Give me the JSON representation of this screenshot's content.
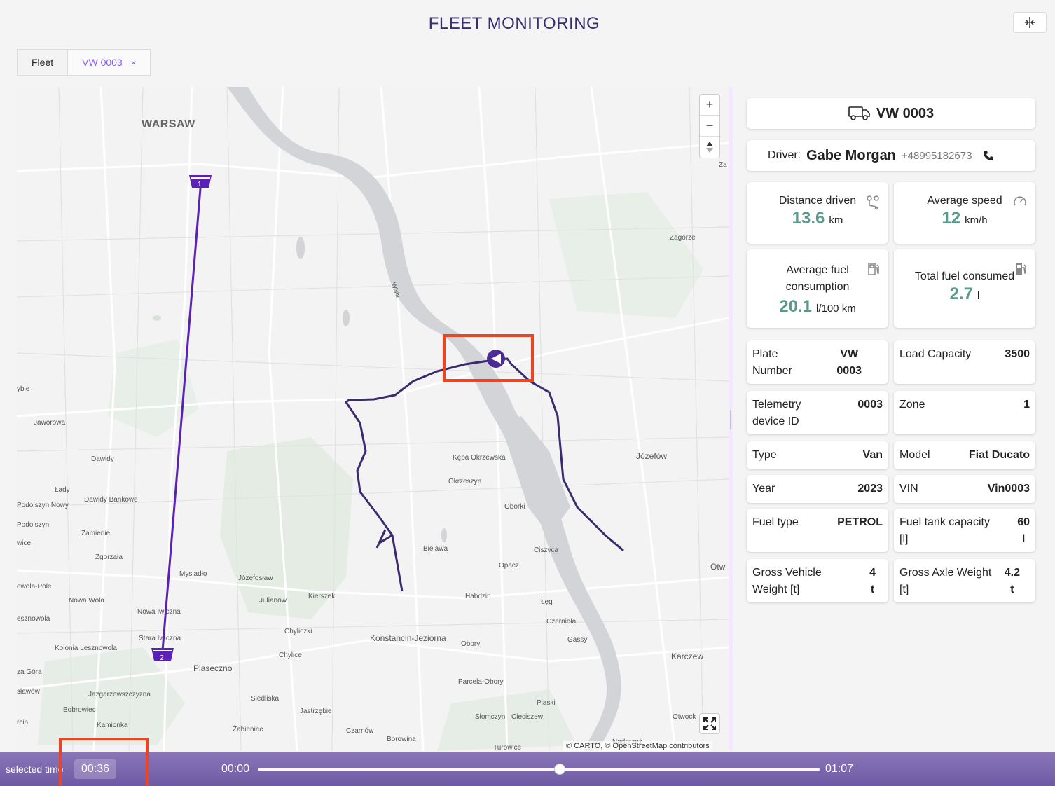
{
  "header": {
    "title": "FLEET MONITORING",
    "layout_toggle_icon": "split-view-icon"
  },
  "tabs": [
    {
      "label": "Fleet",
      "active": false
    },
    {
      "label": "VW 0003",
      "active": true,
      "close": "×"
    }
  ],
  "map": {
    "labels": [
      {
        "text": "WARSAW"
      },
      {
        "text": "Zagórze"
      },
      {
        "text": "Józefów"
      },
      {
        "text": "Kępa Okrzewska"
      },
      {
        "text": "Okrzeszyn"
      },
      {
        "text": "Oborki"
      },
      {
        "text": "Bielawa"
      },
      {
        "text": "Ciszyca"
      },
      {
        "text": "Opacz"
      },
      {
        "text": "Habdzin"
      },
      {
        "text": "Łęg"
      },
      {
        "text": "Czernidła"
      },
      {
        "text": "Gassy"
      },
      {
        "text": "Konstancin-Jeziorna"
      },
      {
        "text": "Obory"
      },
      {
        "text": "Karczew"
      },
      {
        "text": "Piaseczno"
      },
      {
        "text": "Chylice"
      },
      {
        "text": "Chyliczki"
      },
      {
        "text": "Kierszek"
      },
      {
        "text": "Józefosław"
      },
      {
        "text": "Julianów"
      },
      {
        "text": "Mysiadło"
      },
      {
        "text": "Nowa Iwiczna"
      },
      {
        "text": "Stara Iwiczna"
      },
      {
        "text": "Jaworowa"
      },
      {
        "text": "Dawidy"
      },
      {
        "text": "Dawidy Bankowe"
      },
      {
        "text": "Łady"
      },
      {
        "text": "Podolszyn Nowy"
      },
      {
        "text": "Podolszyn"
      },
      {
        "text": "Zamienie"
      },
      {
        "text": "Zgorzała"
      },
      {
        "text": "Nowa Wola"
      },
      {
        "text": "Kolonia Lesznowola"
      },
      {
        "text": "Jazgarzewszczyzna"
      },
      {
        "text": "Bobrowiec"
      },
      {
        "text": "Kamionka"
      },
      {
        "text": "Siedliska"
      },
      {
        "text": "Jastrzębie"
      },
      {
        "text": "Żabieniec"
      },
      {
        "text": "Czarnów"
      },
      {
        "text": "Borowina"
      },
      {
        "text": "Parcela-Obory"
      },
      {
        "text": "Piaski"
      },
      {
        "text": "Słomczyn"
      },
      {
        "text": "Cieciszew"
      },
      {
        "text": "Otwock"
      },
      {
        "text": "Turowice"
      },
      {
        "text": "Nadbrzeż"
      },
      {
        "text": "Otw"
      },
      {
        "text": "ybie"
      },
      {
        "text": "wice"
      },
      {
        "text": "owola-Pole"
      },
      {
        "text": "esznowola"
      },
      {
        "text": "za Góra"
      },
      {
        "text": "sławów"
      },
      {
        "text": "rcin"
      },
      {
        "text": "Wisła"
      },
      {
        "text": "Za"
      }
    ],
    "markers": [
      {
        "label": "1"
      },
      {
        "label": "2"
      }
    ],
    "zoom_in": "+",
    "zoom_out": "−",
    "compass": "▲▼",
    "attribution": "© CARTO, © OpenStreetMap contributors",
    "fullscreen_icon": "fullscreen-icon"
  },
  "vehicle": {
    "name": "VW 0003",
    "icon": "truck-icon",
    "driver_label": "Driver:",
    "driver_name": "Gabe Morgan",
    "driver_phone": "+48995182673",
    "phone_icon": "phone-icon"
  },
  "stats": {
    "distance": {
      "label": "Distance driven",
      "value": "13.6",
      "unit": "km",
      "icon": "route-icon"
    },
    "speed": {
      "label": "Average speed",
      "value": "12",
      "unit": "km/h",
      "icon": "speedometer-icon"
    },
    "fuel_avg": {
      "label_line1": "Average fuel",
      "label_line2": "consumption",
      "value": "20.1",
      "unit": "l/100 km",
      "icon": "fuel-station-icon"
    },
    "fuel_total": {
      "label": "Total fuel consumed",
      "value": "2.7",
      "unit": "l",
      "icon": "fuel-pump-icon"
    }
  },
  "properties": [
    {
      "k1": "Plate",
      "k2": "Number",
      "v1": "VW",
      "v2": "0003"
    },
    {
      "k1": "Load Capacity",
      "k2": "",
      "v1": "3500",
      "v2": ""
    },
    {
      "k1": "Telemetry",
      "k2": "device ID",
      "v1": "0003",
      "v2": ""
    },
    {
      "k1": "Zone",
      "k2": "",
      "v1": "1",
      "v2": ""
    },
    {
      "k1": "Type",
      "k2": "",
      "v1": "Van",
      "v2": ""
    },
    {
      "k1": "Model",
      "k2": "",
      "v1": "Fiat Ducato",
      "v2": ""
    },
    {
      "k1": "Year",
      "k2": "",
      "v1": "2023",
      "v2": ""
    },
    {
      "k1": "VIN",
      "k2": "",
      "v1": "Vin0003",
      "v2": ""
    },
    {
      "k1": "Fuel type",
      "k2": "",
      "v1": "PETROL",
      "v2": ""
    },
    {
      "k1": "Fuel tank capacity",
      "k2": "[l]",
      "v1": "60",
      "v2": "l"
    },
    {
      "k1": "Gross Vehicle",
      "k2": "Weight [t]",
      "v1": "4",
      "v2": "t"
    },
    {
      "k1": "Gross Axle Weight",
      "k2": "[t]",
      "v1": "4.2",
      "v2": "t"
    }
  ],
  "timeline": {
    "label": "selected time",
    "selected": "00:36",
    "start": "00:00",
    "end": "01:07",
    "progress": 0.537
  },
  "colors": {
    "accent": "#8b5cf6",
    "route": "#3b2a6e",
    "trail": "#5b21b6",
    "stat_value": "#5b9a8b",
    "highlight": "#ee4422"
  }
}
